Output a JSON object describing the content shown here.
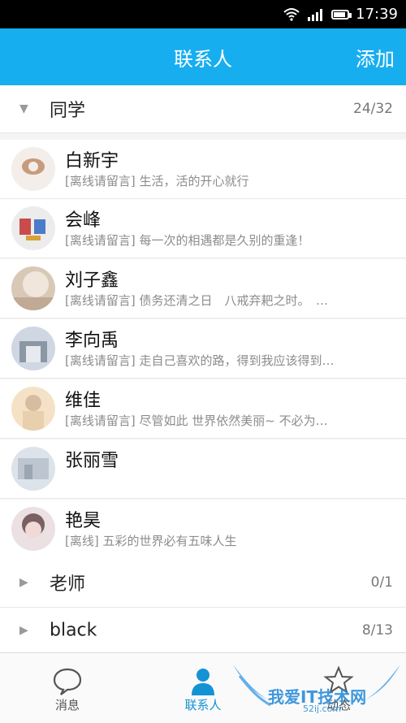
{
  "status_bar": {
    "time": "17:39",
    "battery_level": 0.9
  },
  "app_bar": {
    "title": "联系人",
    "add_label": "添加"
  },
  "groups": [
    {
      "title": "同学",
      "count": "24/32",
      "expanded": true
    },
    {
      "title": "老师",
      "count": "0/1",
      "expanded": false
    },
    {
      "title": "black",
      "count": "8/13",
      "expanded": false
    }
  ],
  "contacts": [
    {
      "name": "白新宇",
      "status": "[离线请留言] 生活，活的开心就行",
      "avatar_colors": [
        "#f3eee9",
        "#c79b7b"
      ]
    },
    {
      "name": "会峰",
      "status": "[离线请留言] 每一次的相遇都是久别的重逢！",
      "avatar_colors": [
        "#e7e7e7",
        "#c94b4b"
      ]
    },
    {
      "name": "刘子鑫",
      "status": "[离线请留言] 债务还清之日　八戒弃耙之时。　…",
      "avatar_colors": [
        "#d9c8b6",
        "#f0e6dc"
      ]
    },
    {
      "name": "李向禹",
      "status": "[离线请留言] 走自己喜欢的路，得到我应该得到…",
      "avatar_colors": [
        "#cfd7e3",
        "#8c97a4"
      ]
    },
    {
      "name": "维佳",
      "status": "[离线请留言] 尽管如此 世界依然美丽~ 不必为…",
      "avatar_colors": [
        "#f5e2c6",
        "#d6bca0"
      ]
    },
    {
      "name": "张丽雪",
      "status": "",
      "avatar_colors": [
        "#dde3ea",
        "#bcc5d0"
      ]
    },
    {
      "name": "艳昊",
      "status": "[离线] 五彩的世界必有五味人生",
      "avatar_colors": [
        "#ebe0e2",
        "#7a5f63"
      ]
    }
  ],
  "tabs": [
    {
      "label": "消息",
      "icon": "speech-bubble-icon"
    },
    {
      "label": "联系人",
      "icon": "person-icon"
    },
    {
      "label": "动态",
      "icon": "star-icon"
    }
  ],
  "watermark": {
    "text": "我爱IT技术网",
    "subtext": "52ij.com"
  }
}
